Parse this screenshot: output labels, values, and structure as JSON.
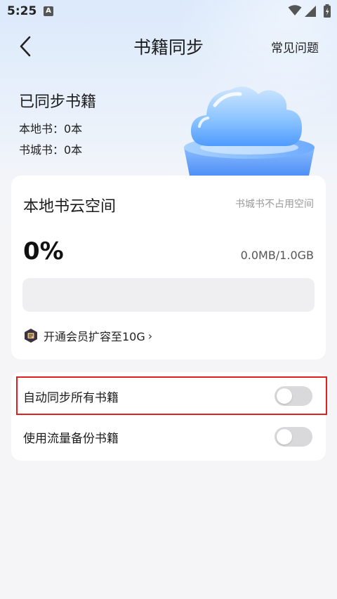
{
  "status_bar": {
    "time": "5:25",
    "notification_icon": "A"
  },
  "header": {
    "title": "书籍同步",
    "faq_label": "常见问题",
    "back_icon": "chevron-left-icon"
  },
  "synced": {
    "title": "已同步书籍",
    "local_books": "本地书：0本",
    "store_books": "书城书：0本"
  },
  "cloud_space": {
    "title": "本地书云空间",
    "note": "书城书不占用空间",
    "percent": "0%",
    "usage": "0.0MB/1.0GB",
    "progress_fraction": 0,
    "upgrade_label": "开通会员扩容至10G",
    "upgrade_chevron": "›"
  },
  "settings": {
    "auto_sync_label": "自动同步所有书籍",
    "auto_sync_on": false,
    "data_backup_label": "使用流量备份书籍",
    "data_backup_on": false
  },
  "colors": {
    "accent": "#4d8cf5",
    "highlight": "#e02020",
    "toggle_off": "#d9d9dc"
  }
}
